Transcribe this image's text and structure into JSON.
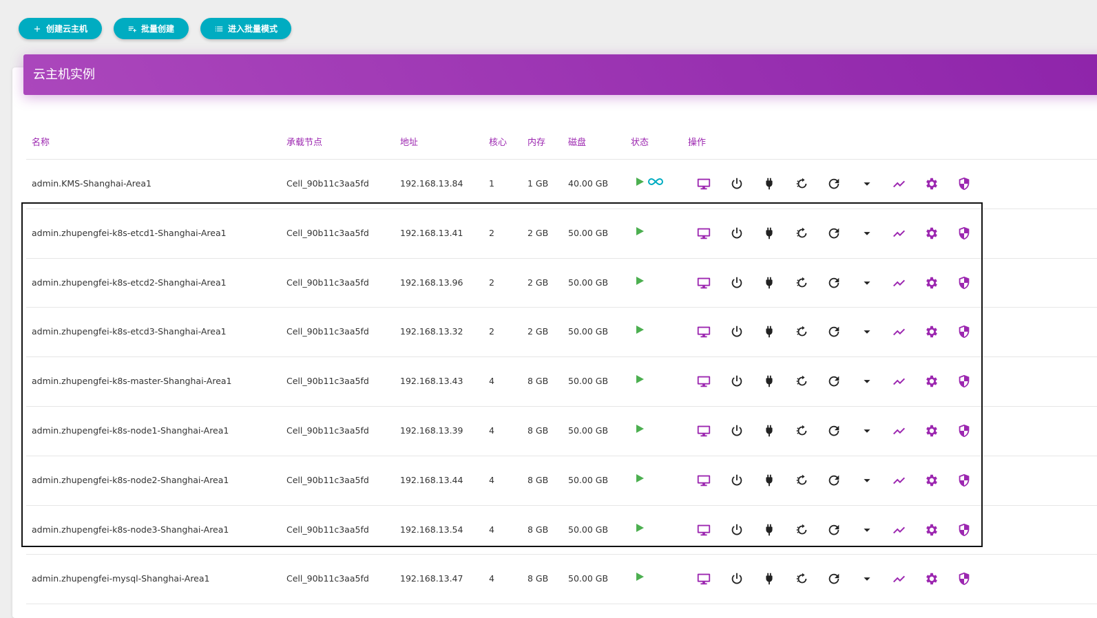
{
  "toolbar": {
    "create_label": "创建云主机",
    "batch_create_label": "批量创建",
    "batch_mode_label": "进入批量模式"
  },
  "panel": {
    "title": "云主机实例"
  },
  "table": {
    "headers": [
      "名称",
      "承载节点",
      "地址",
      "核心",
      "内存",
      "磁盘",
      "状态",
      "操作"
    ],
    "rows": [
      {
        "name": "admin.KMS-Shanghai-Area1",
        "node": "Cell_90b11c3aa5fd",
        "address": "192.168.13.84",
        "cores": "1",
        "memory": "1 GB",
        "disk": "40.00 GB",
        "auto_start": true
      },
      {
        "name": "admin.zhupengfei-k8s-etcd1-Shanghai-Area1",
        "node": "Cell_90b11c3aa5fd",
        "address": "192.168.13.41",
        "cores": "2",
        "memory": "2 GB",
        "disk": "50.00 GB",
        "auto_start": false
      },
      {
        "name": "admin.zhupengfei-k8s-etcd2-Shanghai-Area1",
        "node": "Cell_90b11c3aa5fd",
        "address": "192.168.13.96",
        "cores": "2",
        "memory": "2 GB",
        "disk": "50.00 GB",
        "auto_start": false
      },
      {
        "name": "admin.zhupengfei-k8s-etcd3-Shanghai-Area1",
        "node": "Cell_90b11c3aa5fd",
        "address": "192.168.13.32",
        "cores": "2",
        "memory": "2 GB",
        "disk": "50.00 GB",
        "auto_start": false
      },
      {
        "name": "admin.zhupengfei-k8s-master-Shanghai-Area1",
        "node": "Cell_90b11c3aa5fd",
        "address": "192.168.13.43",
        "cores": "4",
        "memory": "8 GB",
        "disk": "50.00 GB",
        "auto_start": false
      },
      {
        "name": "admin.zhupengfei-k8s-node1-Shanghai-Area1",
        "node": "Cell_90b11c3aa5fd",
        "address": "192.168.13.39",
        "cores": "4",
        "memory": "8 GB",
        "disk": "50.00 GB",
        "auto_start": false
      },
      {
        "name": "admin.zhupengfei-k8s-node2-Shanghai-Area1",
        "node": "Cell_90b11c3aa5fd",
        "address": "192.168.13.44",
        "cores": "4",
        "memory": "8 GB",
        "disk": "50.00 GB",
        "auto_start": false
      },
      {
        "name": "admin.zhupengfei-k8s-node3-Shanghai-Area1",
        "node": "Cell_90b11c3aa5fd",
        "address": "192.168.13.54",
        "cores": "4",
        "memory": "8 GB",
        "disk": "50.00 GB",
        "auto_start": false
      },
      {
        "name": "admin.zhupengfei-mysql-Shanghai-Area1",
        "node": "Cell_90b11c3aa5fd",
        "address": "192.168.13.47",
        "cores": "4",
        "memory": "8 GB",
        "disk": "50.00 GB",
        "auto_start": false
      }
    ],
    "operations": [
      "monitor-icon",
      "power-icon",
      "plug-icon",
      "restart-icon",
      "refresh-icon",
      "dropdown-arrow-icon",
      "chart-trend-icon",
      "settings-gear-icon",
      "security-shield-icon"
    ]
  },
  "colors": {
    "accent": "#9c27b0",
    "button": "#00acc1",
    "running": "#4caf50",
    "dark_icon": "#222222"
  }
}
